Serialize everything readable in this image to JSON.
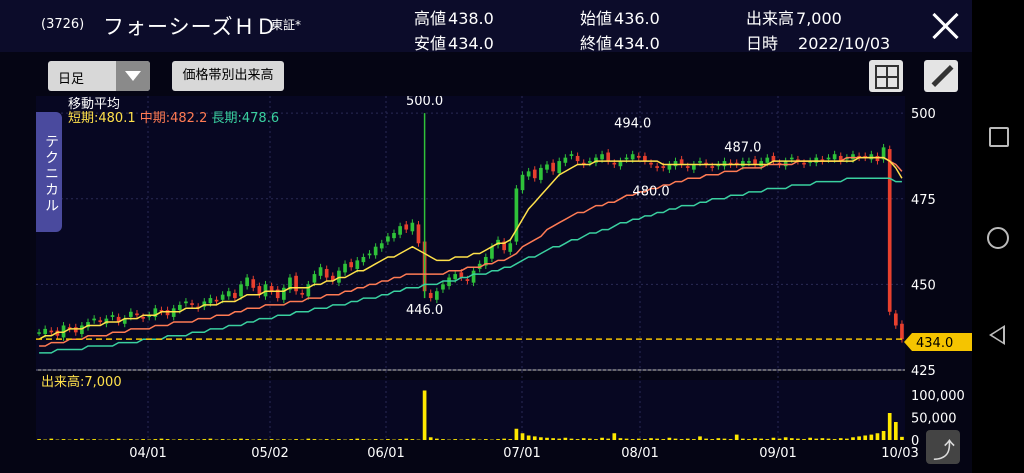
{
  "header": {
    "code": "(3726)",
    "name": "フォーシーズＨＤ",
    "exchange": "東証*",
    "high_label": "高値",
    "high_value": "438.0",
    "low_label": "安値",
    "low_value": "434.0",
    "open_label": "始値",
    "open_value": "436.0",
    "close_label": "終値",
    "close_value": "434.0",
    "volume_label": "出来高",
    "volume_value": "7,000",
    "date_label": "日時",
    "date_value": "2022/10/03"
  },
  "toolbar": {
    "period": "日足",
    "volume_by_price": "価格帯別出来高"
  },
  "side_tab": "テクニカル",
  "ma": {
    "title": "移動平均",
    "short_label": "短期:",
    "short_value": "480.1",
    "mid_label": "中期:",
    "mid_value": "482.2",
    "long_label": "長期:",
    "long_value": "478.6"
  },
  "volume_label": "出来高:7,000",
  "colors": {
    "up": "#2fc23a",
    "down": "#e8402e",
    "ma_short": "#ffe14b",
    "ma_mid": "#ff7b54",
    "ma_long": "#3ad0a0",
    "volume": "#ffe800"
  },
  "chart_data": {
    "type": "candlestick",
    "price_axis": {
      "ticks": [
        500,
        475,
        450,
        425
      ],
      "range": [
        425,
        505
      ]
    },
    "volume_axis": {
      "ticks": [
        "100,000",
        "50,000",
        "0"
      ],
      "range": [
        0,
        120000
      ]
    },
    "x_ticks": [
      "04/01",
      "05/02",
      "06/01",
      "07/01",
      "08/01",
      "09/01",
      "10/03"
    ],
    "annotations": [
      {
        "label": "500.0",
        "value": 500.0
      },
      {
        "label": "446.0",
        "value": 446.0
      },
      {
        "label": "494.0",
        "value": 494.0
      },
      {
        "label": "480.0",
        "value": 480.0
      },
      {
        "label": "487.0",
        "value": 487.0
      }
    ],
    "current_price": {
      "label": "434.0",
      "value": 434.0
    },
    "close_series": [
      436,
      437,
      436,
      435,
      438,
      437,
      436,
      438,
      439,
      440,
      439,
      440,
      441,
      439,
      440,
      442,
      441,
      440,
      441,
      443,
      442,
      441,
      443,
      444,
      445,
      444,
      443,
      445,
      446,
      445,
      447,
      448,
      446,
      450,
      452,
      449,
      447,
      450,
      448,
      446,
      449,
      452,
      448,
      447,
      450,
      453,
      455,
      452,
      451,
      454,
      456,
      455,
      457,
      458,
      459,
      461,
      462,
      464,
      465,
      467,
      466,
      468,
      462,
      448,
      446,
      448,
      450,
      452,
      453,
      452,
      451,
      454,
      456,
      458,
      461,
      463,
      460,
      462,
      478,
      482,
      483,
      481,
      484,
      485,
      483,
      486,
      487,
      488,
      486,
      485,
      486,
      487,
      488,
      486,
      485,
      486,
      487,
      488,
      487,
      486,
      485,
      484,
      484,
      485,
      486,
      485,
      484,
      485,
      486,
      485,
      484,
      485,
      486,
      485,
      485,
      486,
      486,
      485,
      486,
      487,
      486,
      485,
      486,
      487,
      486,
      485,
      486,
      487,
      486,
      487,
      488,
      486,
      487,
      488,
      487,
      487,
      488,
      486,
      490,
      442,
      438,
      434
    ],
    "ma_short": [
      434,
      435,
      435,
      436,
      436,
      437,
      437,
      437,
      438,
      438,
      438,
      439,
      439,
      439,
      440,
      440,
      440,
      441,
      441,
      441,
      442,
      442,
      442,
      442,
      443,
      443,
      443,
      444,
      444,
      444,
      445,
      445,
      445,
      446,
      447,
      447,
      447,
      448,
      448,
      448,
      448,
      449,
      449,
      449,
      449,
      450,
      450,
      451,
      451,
      452,
      452,
      453,
      454,
      454,
      455,
      456,
      457,
      458,
      458,
      459,
      460,
      461,
      460,
      459,
      458,
      457,
      457,
      457,
      458,
      458,
      458,
      459,
      459,
      460,
      461,
      462,
      462,
      463,
      466,
      469,
      472,
      474,
      476,
      478,
      480,
      482,
      483,
      484,
      485,
      485,
      485,
      486,
      486,
      486,
      486,
      486,
      486,
      486,
      486,
      486,
      486,
      486,
      485,
      485,
      485,
      485,
      485,
      485,
      485,
      485,
      485,
      485,
      485,
      485,
      485,
      485,
      485,
      485,
      485,
      485,
      486,
      486,
      486,
      486,
      486,
      486,
      486,
      486,
      486,
      486,
      486,
      486,
      486,
      486,
      487,
      487,
      487,
      487,
      487,
      486,
      484,
      481
    ],
    "ma_mid": [
      432,
      432,
      433,
      433,
      433,
      434,
      434,
      434,
      435,
      435,
      435,
      435,
      436,
      436,
      436,
      437,
      437,
      437,
      437,
      438,
      438,
      438,
      439,
      439,
      439,
      439,
      440,
      440,
      440,
      441,
      441,
      441,
      442,
      442,
      443,
      443,
      443,
      444,
      444,
      444,
      444,
      445,
      445,
      445,
      446,
      446,
      446,
      447,
      447,
      447,
      448,
      448,
      449,
      449,
      450,
      450,
      451,
      451,
      452,
      452,
      453,
      453,
      453,
      453,
      453,
      453,
      453,
      454,
      454,
      454,
      455,
      455,
      455,
      456,
      456,
      457,
      457,
      458,
      459,
      461,
      462,
      463,
      464,
      466,
      467,
      468,
      469,
      470,
      471,
      471,
      472,
      473,
      473,
      474,
      474,
      475,
      476,
      476,
      477,
      477,
      478,
      478,
      479,
      479,
      480,
      480,
      481,
      481,
      481,
      482,
      482,
      482,
      483,
      483,
      483,
      484,
      484,
      484,
      484,
      485,
      485,
      485,
      485,
      485,
      486,
      486,
      486,
      486,
      486,
      486,
      486,
      486,
      487,
      487,
      487,
      487,
      487,
      487,
      487,
      486,
      485,
      483
    ],
    "ma_long": [
      430,
      430,
      430,
      431,
      431,
      431,
      431,
      431,
      432,
      432,
      432,
      432,
      432,
      433,
      433,
      433,
      433,
      434,
      434,
      434,
      434,
      435,
      435,
      435,
      435,
      436,
      436,
      436,
      437,
      437,
      437,
      438,
      438,
      438,
      439,
      439,
      440,
      440,
      440,
      441,
      441,
      441,
      442,
      442,
      442,
      443,
      443,
      443,
      444,
      444,
      444,
      445,
      445,
      446,
      446,
      446,
      447,
      447,
      448,
      448,
      449,
      449,
      449,
      450,
      450,
      450,
      451,
      451,
      451,
      452,
      452,
      453,
      453,
      453,
      454,
      454,
      455,
      455,
      456,
      457,
      458,
      458,
      459,
      460,
      461,
      461,
      462,
      463,
      463,
      464,
      465,
      465,
      466,
      466,
      467,
      468,
      468,
      469,
      469,
      470,
      470,
      471,
      471,
      472,
      472,
      473,
      473,
      473,
      474,
      474,
      475,
      475,
      475,
      476,
      476,
      476,
      477,
      477,
      477,
      478,
      478,
      478,
      478,
      479,
      479,
      479,
      479,
      480,
      480,
      480,
      480,
      480,
      481,
      481,
      481,
      481,
      481,
      481,
      481,
      481,
      480,
      480
    ],
    "volume": [
      2000,
      1000,
      3000,
      1000,
      2000,
      1000,
      2000,
      3000,
      1000,
      2000,
      1000,
      1000,
      2000,
      3000,
      1000,
      2000,
      1000,
      2000,
      1000,
      2000,
      3000,
      2000,
      1000,
      2000,
      1000,
      2000,
      1000,
      2000,
      3000,
      1000,
      2000,
      1000,
      2000,
      3000,
      2000,
      1000,
      2000,
      1000,
      2000,
      1000,
      2000,
      1000,
      2000,
      1000,
      3000,
      2000,
      1000,
      2000,
      1000,
      2000,
      1000,
      2000,
      3000,
      2000,
      1000,
      2000,
      1000,
      2000,
      1000,
      2000,
      3000,
      2000,
      1000,
      110000,
      6000,
      3000,
      2000,
      1000,
      2000,
      1000,
      2000,
      3000,
      1000,
      2000,
      1000,
      2000,
      3000,
      2000,
      25000,
      15000,
      10000,
      8000,
      6000,
      5000,
      4000,
      3000,
      5000,
      3000,
      2000,
      4000,
      3000,
      2000,
      5000,
      3000,
      15000,
      4000,
      3000,
      2000,
      3000,
      2000,
      4000,
      3000,
      2000,
      5000,
      3000,
      2000,
      3000,
      2000,
      8000,
      3000,
      2000,
      4000,
      3000,
      2000,
      12000,
      3000,
      2000,
      4000,
      3000,
      2000,
      5000,
      3000,
      6000,
      4000,
      3000,
      2000,
      5000,
      3000,
      4000,
      3000,
      2000,
      4000,
      3000,
      6000,
      8000,
      10000,
      12000,
      15000,
      20000,
      60000,
      40000,
      7000
    ]
  }
}
